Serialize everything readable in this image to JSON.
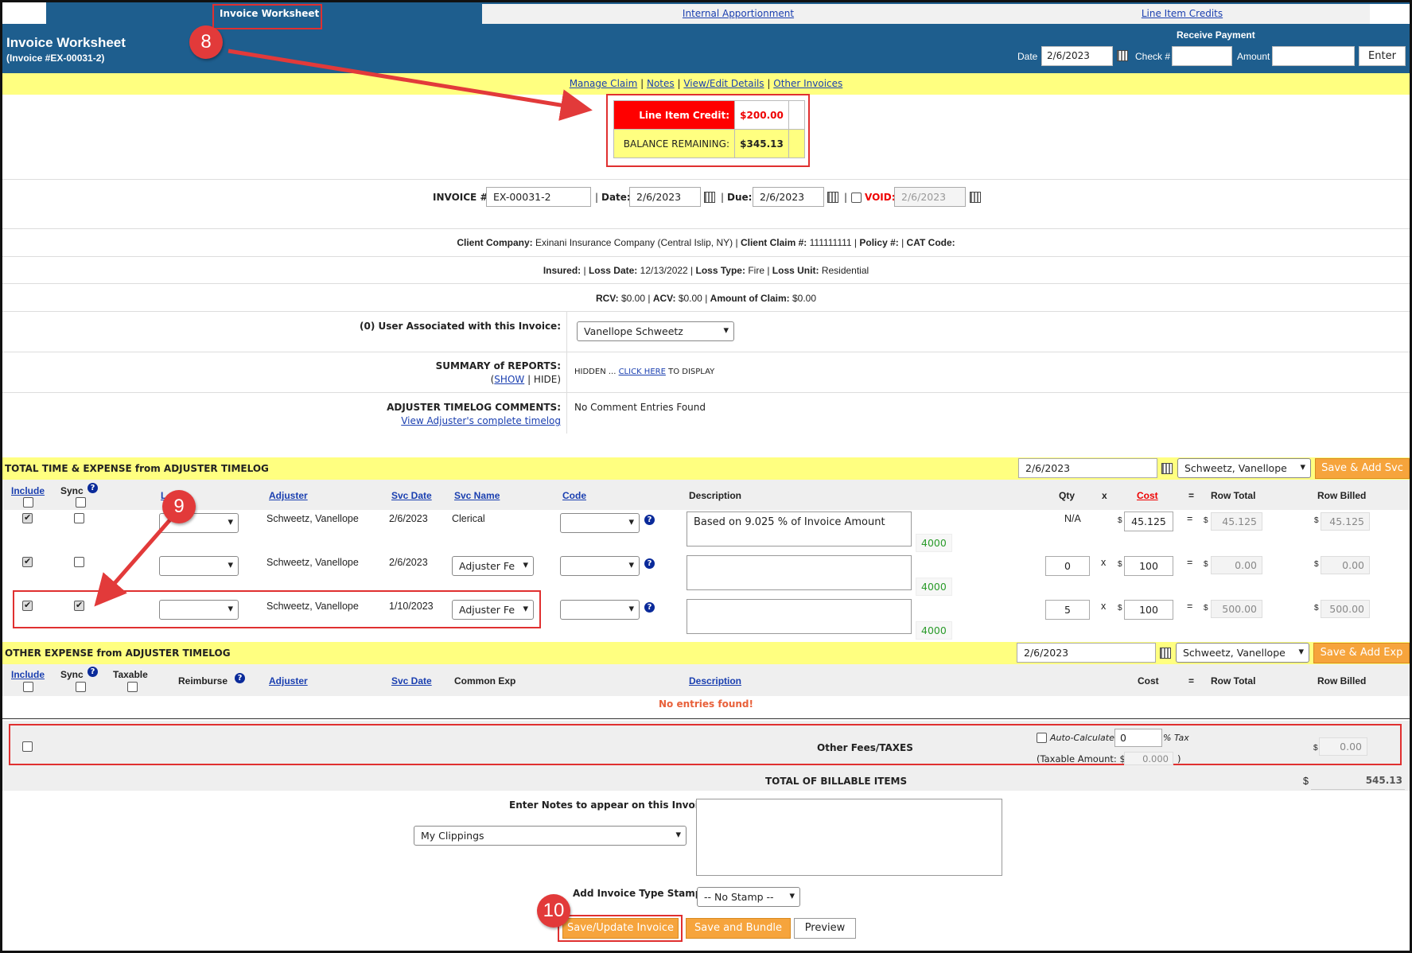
{
  "tabs": [
    {
      "label": "Invoice Worksheet",
      "active": true
    },
    {
      "label": "Internal Apportionment",
      "active": false
    },
    {
      "label": "Line Item Credits",
      "active": false
    }
  ],
  "header": {
    "title": "Invoice Worksheet",
    "subtitle": "(Invoice #EX-00031-2)",
    "receive_payment": {
      "title": "Receive Payment",
      "date_label": "Date",
      "date_value": "2/6/2023",
      "check_label": "Check #",
      "check_value": "",
      "amount_label": "Amount",
      "amount_value": "",
      "enter_label": "Enter"
    }
  },
  "links": {
    "manage_claim": "Manage Claim",
    "notes": "Notes",
    "view_edit": "View/Edit Details",
    "other_invoices": "Other Invoices",
    "sep": "|"
  },
  "credit": {
    "line_item_label": "Line Item Credit:",
    "line_item_value": "$200.00",
    "balance_label": "BALANCE REMAINING:",
    "balance_value": "$345.13"
  },
  "invoice": {
    "number_label": "INVOICE #:",
    "number_value": "EX-00031-2",
    "date_label": "Date:",
    "date_value": "2/6/2023",
    "due_label": "Due:",
    "due_value": "2/6/2023",
    "void_label": "VOID:",
    "void_value": "2/6/2023"
  },
  "claim_info": {
    "client_company_label": "Client Company:",
    "client_company": "Exinani Insurance Company (Central Islip, NY)",
    "client_claim_label": "Client Claim #:",
    "client_claim": "111111111",
    "policy_label": "Policy #:",
    "cat_label": "CAT Code:",
    "insured_label": "Insured:",
    "loss_date_label": "Loss Date:",
    "loss_date": "12/13/2022",
    "loss_type_label": "Loss Type:",
    "loss_type": "Fire",
    "loss_unit_label": "Loss Unit:",
    "loss_unit": "Residential",
    "rcv_label": "RCV:",
    "rcv": "$0.00",
    "acv_label": "ACV:",
    "acv": "$0.00",
    "amount_claim_label": "Amount of Claim:",
    "amount_claim": "$0.00"
  },
  "assoc": {
    "user_label": "(0) User Associated with this Invoice:",
    "user_value": "Vanellope Schweetz",
    "summary_label": "SUMMARY of REPORTS:",
    "show": "SHOW",
    "hide": "HIDE",
    "hidden_text": "HIDDEN ...",
    "click_here": "CLICK HERE",
    "to_display": "TO DISPLAY",
    "comments_label": "ADJUSTER TIMELOG COMMENTS:",
    "view_timelog": "View Adjuster's complete timelog",
    "no_comments": "No Comment Entries Found"
  },
  "time_expense": {
    "title": "TOTAL TIME & EXPENSE from ADJUSTER TIMELOG",
    "date": "2/6/2023",
    "adjuster": "Schweetz, Vanellope",
    "save_btn": "Save & Add Svc",
    "columns": {
      "include": "Include",
      "sync": "Sync",
      "l": "L",
      "adjuster": "Adjuster",
      "svc_date": "Svc Date",
      "svc_name": "Svc Name",
      "code": "Code",
      "description": "Description",
      "qty": "Qty",
      "x": "x",
      "cost": "Cost",
      "eq": "=",
      "row_total": "Row Total",
      "row_billed": "Row Billed"
    },
    "rows": [
      {
        "adjuster": "Schweetz, Vanellope",
        "date": "2/6/2023",
        "svc_name": "Clerical",
        "description": "Based on 9.025 % of Invoice Amount",
        "code_num": "4000",
        "qty": "N/A",
        "cost": "45.125",
        "row_total": "45.125",
        "row_billed": "45.125",
        "include": true,
        "sync": false
      },
      {
        "adjuster": "Schweetz, Vanellope",
        "date": "2/6/2023",
        "svc_name": "Adjuster Fe",
        "description": "",
        "code_num": "4000",
        "qty": "0",
        "cost": "100",
        "row_total": "0.00",
        "row_billed": "0.00",
        "include": true,
        "sync": false
      },
      {
        "adjuster": "Schweetz, Vanellope",
        "date": "1/10/2023",
        "svc_name": "Adjuster Fe",
        "description": "",
        "code_num": "4000",
        "qty": "5",
        "cost": "100",
        "row_total": "500.00",
        "row_billed": "500.00",
        "include": true,
        "sync": true
      }
    ]
  },
  "other_expense": {
    "title": "OTHER EXPENSE from ADJUSTER TIMELOG",
    "date": "2/6/2023",
    "adjuster": "Schweetz, Vanellope",
    "save_btn": "Save & Add Exp",
    "columns": {
      "include": "Include",
      "sync": "Sync",
      "taxable": "Taxable",
      "reimburse": "Reimburse",
      "adjuster": "Adjuster",
      "svc_date": "Svc Date",
      "common_exp": "Common Exp",
      "description": "Description",
      "cost": "Cost",
      "eq": "=",
      "row_total": "Row Total",
      "row_billed": "Row Billed"
    },
    "empty": "No entries found!"
  },
  "fees": {
    "label": "Other Fees/TAXES",
    "auto_calc": "Auto-Calculate",
    "tax_value": "0",
    "tax_label": "% Tax",
    "taxable_label": "(Taxable Amount: $",
    "taxable_value": "0.000",
    "taxable_close": ")",
    "fee_value": "0.00"
  },
  "totals": {
    "label": "TOTAL OF BILLABLE ITEMS",
    "value": "545.13"
  },
  "notes": {
    "label": "Enter Notes to appear on this Invoice",
    "clippings": "My Clippings",
    "stamp_label": "Add Invoice Type Stamp",
    "stamp_value": "-- No Stamp --"
  },
  "actions": {
    "save_update": "Save/Update Invoice",
    "save_bundle": "Save and Bundle",
    "preview": "Preview"
  },
  "callouts": [
    "8",
    "9",
    "10"
  ],
  "currency": "$"
}
